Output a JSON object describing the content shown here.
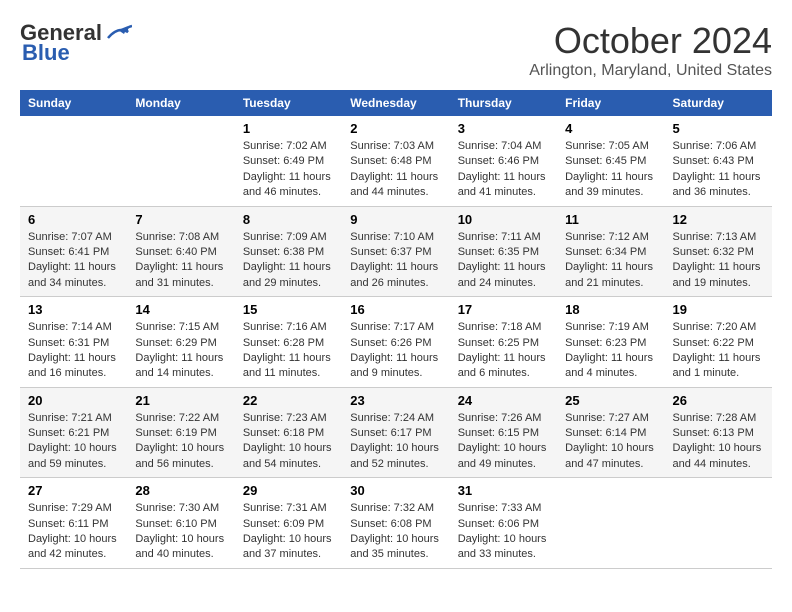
{
  "header": {
    "logo_general": "General",
    "logo_blue": "Blue",
    "title": "October 2024",
    "location": "Arlington, Maryland, United States"
  },
  "weekdays": [
    "Sunday",
    "Monday",
    "Tuesday",
    "Wednesday",
    "Thursday",
    "Friday",
    "Saturday"
  ],
  "weeks": [
    [
      {
        "day": "",
        "sunrise": "",
        "sunset": "",
        "daylight": ""
      },
      {
        "day": "",
        "sunrise": "",
        "sunset": "",
        "daylight": ""
      },
      {
        "day": "1",
        "sunrise": "Sunrise: 7:02 AM",
        "sunset": "Sunset: 6:49 PM",
        "daylight": "Daylight: 11 hours and 46 minutes."
      },
      {
        "day": "2",
        "sunrise": "Sunrise: 7:03 AM",
        "sunset": "Sunset: 6:48 PM",
        "daylight": "Daylight: 11 hours and 44 minutes."
      },
      {
        "day": "3",
        "sunrise": "Sunrise: 7:04 AM",
        "sunset": "Sunset: 6:46 PM",
        "daylight": "Daylight: 11 hours and 41 minutes."
      },
      {
        "day": "4",
        "sunrise": "Sunrise: 7:05 AM",
        "sunset": "Sunset: 6:45 PM",
        "daylight": "Daylight: 11 hours and 39 minutes."
      },
      {
        "day": "5",
        "sunrise": "Sunrise: 7:06 AM",
        "sunset": "Sunset: 6:43 PM",
        "daylight": "Daylight: 11 hours and 36 minutes."
      }
    ],
    [
      {
        "day": "6",
        "sunrise": "Sunrise: 7:07 AM",
        "sunset": "Sunset: 6:41 PM",
        "daylight": "Daylight: 11 hours and 34 minutes."
      },
      {
        "day": "7",
        "sunrise": "Sunrise: 7:08 AM",
        "sunset": "Sunset: 6:40 PM",
        "daylight": "Daylight: 11 hours and 31 minutes."
      },
      {
        "day": "8",
        "sunrise": "Sunrise: 7:09 AM",
        "sunset": "Sunset: 6:38 PM",
        "daylight": "Daylight: 11 hours and 29 minutes."
      },
      {
        "day": "9",
        "sunrise": "Sunrise: 7:10 AM",
        "sunset": "Sunset: 6:37 PM",
        "daylight": "Daylight: 11 hours and 26 minutes."
      },
      {
        "day": "10",
        "sunrise": "Sunrise: 7:11 AM",
        "sunset": "Sunset: 6:35 PM",
        "daylight": "Daylight: 11 hours and 24 minutes."
      },
      {
        "day": "11",
        "sunrise": "Sunrise: 7:12 AM",
        "sunset": "Sunset: 6:34 PM",
        "daylight": "Daylight: 11 hours and 21 minutes."
      },
      {
        "day": "12",
        "sunrise": "Sunrise: 7:13 AM",
        "sunset": "Sunset: 6:32 PM",
        "daylight": "Daylight: 11 hours and 19 minutes."
      }
    ],
    [
      {
        "day": "13",
        "sunrise": "Sunrise: 7:14 AM",
        "sunset": "Sunset: 6:31 PM",
        "daylight": "Daylight: 11 hours and 16 minutes."
      },
      {
        "day": "14",
        "sunrise": "Sunrise: 7:15 AM",
        "sunset": "Sunset: 6:29 PM",
        "daylight": "Daylight: 11 hours and 14 minutes."
      },
      {
        "day": "15",
        "sunrise": "Sunrise: 7:16 AM",
        "sunset": "Sunset: 6:28 PM",
        "daylight": "Daylight: 11 hours and 11 minutes."
      },
      {
        "day": "16",
        "sunrise": "Sunrise: 7:17 AM",
        "sunset": "Sunset: 6:26 PM",
        "daylight": "Daylight: 11 hours and 9 minutes."
      },
      {
        "day": "17",
        "sunrise": "Sunrise: 7:18 AM",
        "sunset": "Sunset: 6:25 PM",
        "daylight": "Daylight: 11 hours and 6 minutes."
      },
      {
        "day": "18",
        "sunrise": "Sunrise: 7:19 AM",
        "sunset": "Sunset: 6:23 PM",
        "daylight": "Daylight: 11 hours and 4 minutes."
      },
      {
        "day": "19",
        "sunrise": "Sunrise: 7:20 AM",
        "sunset": "Sunset: 6:22 PM",
        "daylight": "Daylight: 11 hours and 1 minute."
      }
    ],
    [
      {
        "day": "20",
        "sunrise": "Sunrise: 7:21 AM",
        "sunset": "Sunset: 6:21 PM",
        "daylight": "Daylight: 10 hours and 59 minutes."
      },
      {
        "day": "21",
        "sunrise": "Sunrise: 7:22 AM",
        "sunset": "Sunset: 6:19 PM",
        "daylight": "Daylight: 10 hours and 56 minutes."
      },
      {
        "day": "22",
        "sunrise": "Sunrise: 7:23 AM",
        "sunset": "Sunset: 6:18 PM",
        "daylight": "Daylight: 10 hours and 54 minutes."
      },
      {
        "day": "23",
        "sunrise": "Sunrise: 7:24 AM",
        "sunset": "Sunset: 6:17 PM",
        "daylight": "Daylight: 10 hours and 52 minutes."
      },
      {
        "day": "24",
        "sunrise": "Sunrise: 7:26 AM",
        "sunset": "Sunset: 6:15 PM",
        "daylight": "Daylight: 10 hours and 49 minutes."
      },
      {
        "day": "25",
        "sunrise": "Sunrise: 7:27 AM",
        "sunset": "Sunset: 6:14 PM",
        "daylight": "Daylight: 10 hours and 47 minutes."
      },
      {
        "day": "26",
        "sunrise": "Sunrise: 7:28 AM",
        "sunset": "Sunset: 6:13 PM",
        "daylight": "Daylight: 10 hours and 44 minutes."
      }
    ],
    [
      {
        "day": "27",
        "sunrise": "Sunrise: 7:29 AM",
        "sunset": "Sunset: 6:11 PM",
        "daylight": "Daylight: 10 hours and 42 minutes."
      },
      {
        "day": "28",
        "sunrise": "Sunrise: 7:30 AM",
        "sunset": "Sunset: 6:10 PM",
        "daylight": "Daylight: 10 hours and 40 minutes."
      },
      {
        "day": "29",
        "sunrise": "Sunrise: 7:31 AM",
        "sunset": "Sunset: 6:09 PM",
        "daylight": "Daylight: 10 hours and 37 minutes."
      },
      {
        "day": "30",
        "sunrise": "Sunrise: 7:32 AM",
        "sunset": "Sunset: 6:08 PM",
        "daylight": "Daylight: 10 hours and 35 minutes."
      },
      {
        "day": "31",
        "sunrise": "Sunrise: 7:33 AM",
        "sunset": "Sunset: 6:06 PM",
        "daylight": "Daylight: 10 hours and 33 minutes."
      },
      {
        "day": "",
        "sunrise": "",
        "sunset": "",
        "daylight": ""
      },
      {
        "day": "",
        "sunrise": "",
        "sunset": "",
        "daylight": ""
      }
    ]
  ]
}
